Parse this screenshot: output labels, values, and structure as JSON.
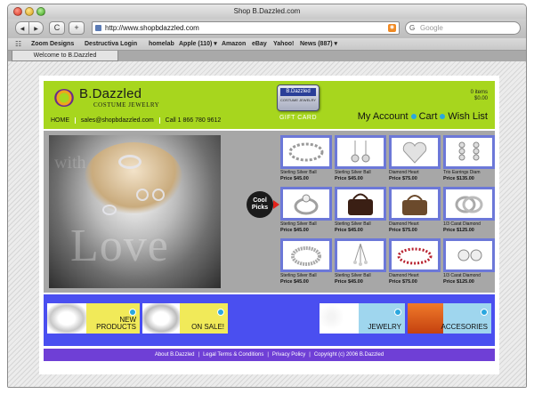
{
  "browser": {
    "window_title": "Shop B.Dazzled.com",
    "url": "http://www.shopbdazzled.com",
    "search_placeholder": "Google",
    "search_engine_icon": "G",
    "back_icon": "◀",
    "forward_icon": "▶",
    "reload_icon": "C",
    "newtab_icon": "+",
    "bookmarks": [
      "Zoom Designs",
      "Destructiva Login",
      "homelab",
      "Apple (110) ▾",
      "Amazon",
      "eBay",
      "Yahoo!",
      "News (887) ▾"
    ],
    "tab_label": "Welcome to B.Dazzled"
  },
  "site": {
    "logo_name": "B.Dazzled",
    "logo_subtitle": "COSTUME JEWELRY",
    "giftcard_brand": "B.Dazzled",
    "giftcard_sub": "COSTUME JEWELRY",
    "giftcard_label": "GIFT CARD",
    "cart_items": "0 items",
    "cart_total": "$0.00",
    "nav_home": "HOME",
    "nav_email": "sales@shopbdazzled.com",
    "nav_phone": "Call 1 866 780 9612",
    "nav_account": "My Account",
    "nav_cart": "Cart",
    "nav_wishlist": "Wish List",
    "hero_text": "Love",
    "hero_text2": "with",
    "cool_picks_line1": "Cool",
    "cool_picks_line2": "Picks",
    "accent_blue": "#2aa7df",
    "header_green": "#a7d61e",
    "promo_blue": "#4a4ff0",
    "footer_purple": "#6f3fd6"
  },
  "products": [
    {
      "title": "Sterling Silver Ball",
      "price": "Price $45.00",
      "kind": "bracelet"
    },
    {
      "title": "Sterling Silver Ball",
      "price": "Price $45.00",
      "kind": "earrings"
    },
    {
      "title": "Diamond Heart",
      "price": "Price $75.00",
      "kind": "heart"
    },
    {
      "title": "Trio Earrings Diam",
      "price": "Price $135.00",
      "kind": "trio"
    },
    {
      "title": "Sterling Silver Ball",
      "price": "Price $45.00",
      "kind": "ring"
    },
    {
      "title": "Sterling Silver Ball",
      "price": "Price $45.00",
      "kind": "bag"
    },
    {
      "title": "Diamond Heart",
      "price": "Price $75.00",
      "kind": "handbag"
    },
    {
      "title": "1/3 Carat Diamond",
      "price": "Price $125.00",
      "kind": "rings"
    },
    {
      "title": "Sterling Silver Ball",
      "price": "Price $45.00",
      "kind": "band"
    },
    {
      "title": "Sterling Silver Ball",
      "price": "Price $45.00",
      "kind": "drops"
    },
    {
      "title": "Diamond Heart",
      "price": "Price $75.00",
      "kind": "tennis"
    },
    {
      "title": "1/3 Carat Diamond",
      "price": "Price $125.00",
      "kind": "studs"
    }
  ],
  "promos": {
    "new_products_line1": "NEW",
    "new_products_line2": "PRODUCTS",
    "on_sale": "ON SALE!",
    "jewelry": "JEWELRY",
    "accessories": "ACCESORIES"
  },
  "footer": {
    "about": "About B.Dazzled",
    "legal": "Legal Terms & Conditions",
    "privacy": "Privacy Policy",
    "copyright": "Copyright (c) 2006 B.Dazzled"
  }
}
